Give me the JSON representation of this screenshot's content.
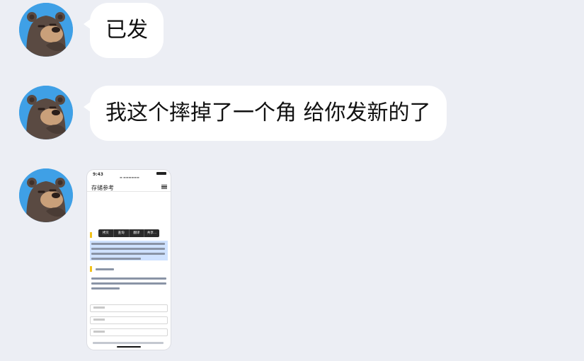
{
  "colors": {
    "background": "#eceef4",
    "bubble": "#ffffff",
    "avatar_bg": "#3fa0e6",
    "bear_fur": "#5a4a42",
    "bear_muzzle": "#c9a07a"
  },
  "messages": [
    {
      "type": "text",
      "text": "已发",
      "avatar_icon": "bear-avatar-icon"
    },
    {
      "type": "text",
      "text": "我这个摔掉了一个角 给你发新的了",
      "avatar_icon": "bear-avatar-icon"
    },
    {
      "type": "image",
      "avatar_icon": "bear-avatar-icon"
    }
  ],
  "screenshot": {
    "time": "9:43",
    "page_title": "存储参考",
    "context_menu": [
      "拷贝",
      "查询",
      "翻译",
      "共享…"
    ]
  }
}
